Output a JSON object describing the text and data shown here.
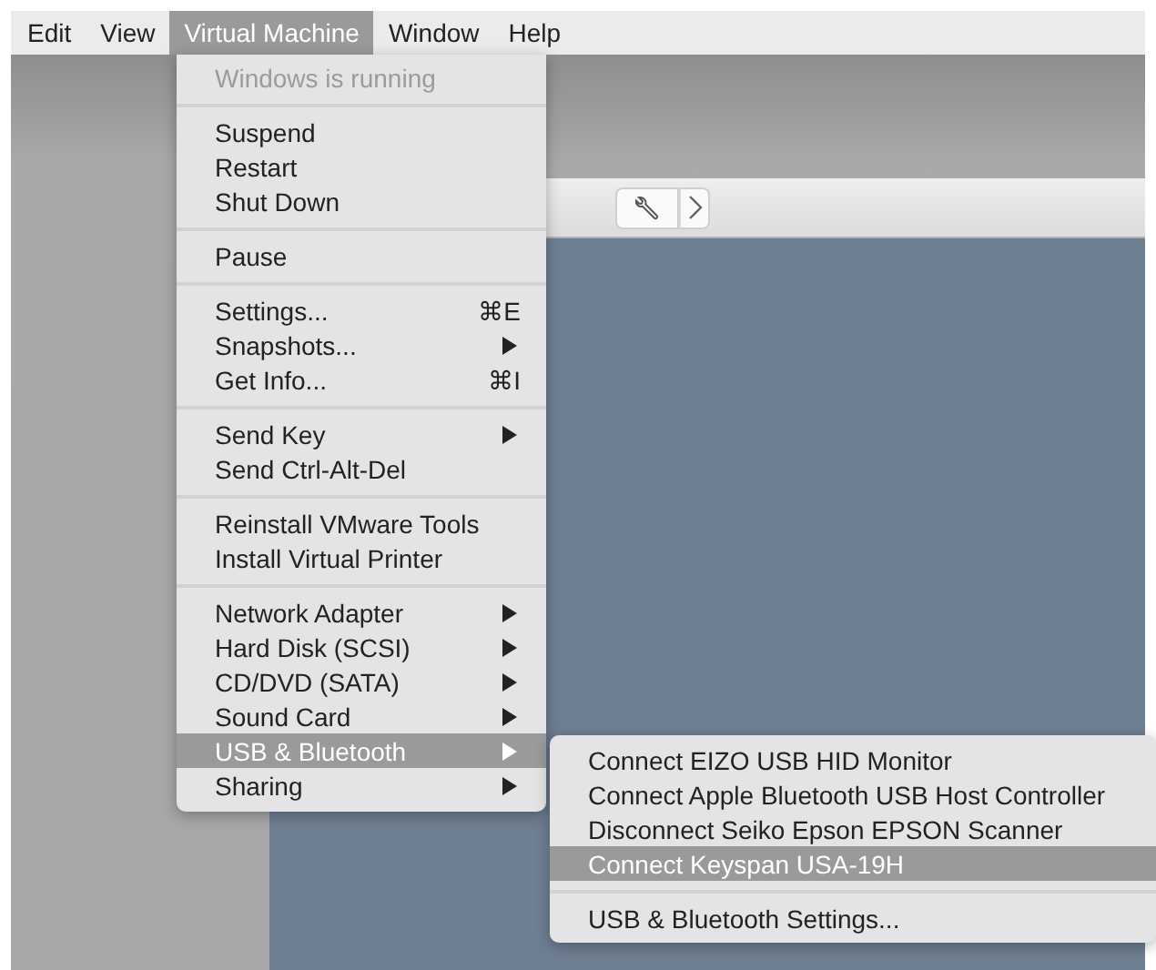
{
  "menubar": [
    {
      "label": "Edit",
      "selected": false
    },
    {
      "label": "View",
      "selected": false
    },
    {
      "label": "Virtual Machine",
      "selected": true
    },
    {
      "label": "Window",
      "selected": false
    },
    {
      "label": "Help",
      "selected": false
    }
  ],
  "menu": {
    "items": [
      {
        "kind": "item",
        "label": "Windows is running",
        "disabled": true,
        "selected": false,
        "submenu": false
      },
      {
        "kind": "separator"
      },
      {
        "kind": "item",
        "label": "Suspend",
        "disabled": false,
        "selected": false,
        "submenu": false
      },
      {
        "kind": "item",
        "label": "Restart",
        "disabled": false,
        "selected": false,
        "submenu": false
      },
      {
        "kind": "item",
        "label": "Shut Down",
        "disabled": false,
        "selected": false,
        "submenu": false
      },
      {
        "kind": "separator"
      },
      {
        "kind": "item",
        "label": "Pause",
        "disabled": false,
        "selected": false,
        "submenu": false
      },
      {
        "kind": "separator"
      },
      {
        "kind": "item",
        "label": "Settings...",
        "shortcut": "⌘E",
        "disabled": false,
        "selected": false,
        "submenu": false
      },
      {
        "kind": "item",
        "label": "Snapshots...",
        "disabled": false,
        "selected": false,
        "submenu": true
      },
      {
        "kind": "item",
        "label": "Get Info...",
        "shortcut": "⌘I",
        "disabled": false,
        "selected": false,
        "submenu": false
      },
      {
        "kind": "separator"
      },
      {
        "kind": "item",
        "label": "Send Key",
        "disabled": false,
        "selected": false,
        "submenu": true
      },
      {
        "kind": "item",
        "label": "Send Ctrl-Alt-Del",
        "disabled": false,
        "selected": false,
        "submenu": false
      },
      {
        "kind": "separator"
      },
      {
        "kind": "item",
        "label": "Reinstall VMware Tools",
        "disabled": false,
        "selected": false,
        "submenu": false
      },
      {
        "kind": "item",
        "label": "Install Virtual Printer",
        "disabled": false,
        "selected": false,
        "submenu": false
      },
      {
        "kind": "separator"
      },
      {
        "kind": "item",
        "label": "Network Adapter",
        "disabled": false,
        "selected": false,
        "submenu": true
      },
      {
        "kind": "item",
        "label": "Hard Disk (SCSI)",
        "disabled": false,
        "selected": false,
        "submenu": true
      },
      {
        "kind": "item",
        "label": "CD/DVD (SATA)",
        "disabled": false,
        "selected": false,
        "submenu": true
      },
      {
        "kind": "item",
        "label": "Sound Card",
        "disabled": false,
        "selected": false,
        "submenu": true
      },
      {
        "kind": "item",
        "label": "USB & Bluetooth",
        "disabled": false,
        "selected": true,
        "submenu": true
      },
      {
        "kind": "item",
        "label": "Sharing",
        "disabled": false,
        "selected": false,
        "submenu": true
      }
    ]
  },
  "submenu": {
    "items": [
      {
        "kind": "item",
        "label": "Connect EIZO USB HID Monitor",
        "selected": false
      },
      {
        "kind": "item",
        "label": "Connect Apple Bluetooth USB Host Controller",
        "selected": false
      },
      {
        "kind": "item",
        "label": "Disconnect Seiko Epson EPSON Scanner",
        "selected": false
      },
      {
        "kind": "item",
        "label": "Connect Keyspan USA-19H",
        "selected": true
      },
      {
        "kind": "separator"
      },
      {
        "kind": "item",
        "label": "USB & Bluetooth Settings...",
        "selected": false
      }
    ]
  }
}
